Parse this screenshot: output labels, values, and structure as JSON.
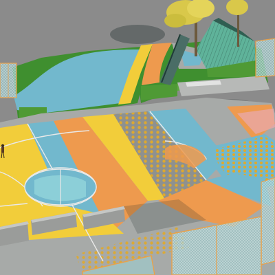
{
  "palette": {
    "ground": "#8b8b8b",
    "grass": "#3f8f2f",
    "grass_dark": "#2f6f22",
    "hedge": "#4f9a35",
    "yellow": "#f2cd3a",
    "orange": "#ee9a4e",
    "blue": "#72b8cd",
    "teal": "#8ccfd8",
    "gray": "#a7aaa8",
    "gray_dark": "#8e918f",
    "white_line": "#e9e9e9",
    "dot": "#e0a92c",
    "fence_frame": "#e9a14a",
    "fence_mesh": "#9fc7c8",
    "slide": "#5fb39a",
    "slide_dark": "#2f5f52",
    "tree_leaf": "#d9c84a",
    "tree_trunk": "#6c5a3e",
    "shadow": "#1e2a2a",
    "bench": "#9a9c9a",
    "pink": "#e8a7a6"
  }
}
